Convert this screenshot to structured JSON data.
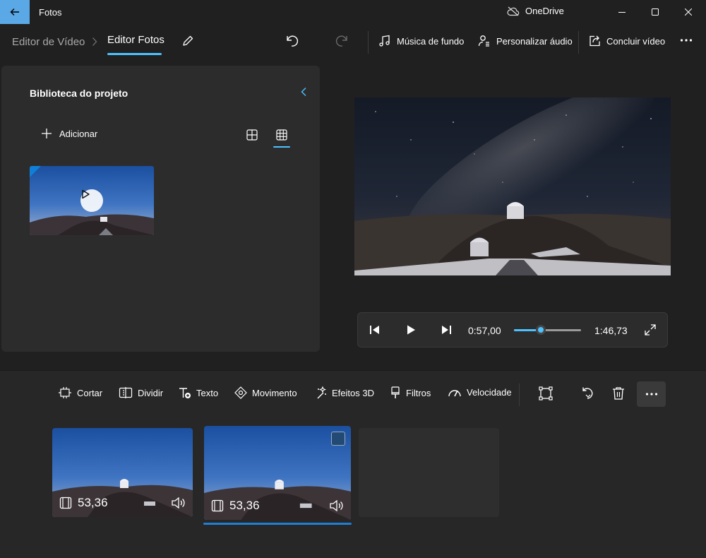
{
  "window": {
    "title": "Fotos",
    "onedrive_label": "OneDrive",
    "icons": [
      "back-arrow-icon",
      "cloud-off-icon",
      "minimize-icon",
      "maximize-icon",
      "close-icon"
    ]
  },
  "toolbar": {
    "breadcrumb": [
      "Editor de Vídeo",
      "Editor Fotos"
    ],
    "buttons": {
      "music": "Música de fundo",
      "audio": "Personalizar áudio",
      "finish": "Concluir vídeo"
    },
    "icons": [
      "pencil-icon",
      "undo-icon",
      "redo-icon",
      "music-note-icon",
      "custom-audio-icon",
      "share-icon",
      "more-icon"
    ]
  },
  "library": {
    "title": "Biblioteca do projeto",
    "add_label": "Adicionar",
    "view_modes": [
      "grid-large",
      "grid-small"
    ],
    "selected_view": "grid-small"
  },
  "player": {
    "current_time": "0:57,00",
    "total_time": "1:46,73",
    "progress": 0.4
  },
  "storyboard": {
    "tools": [
      "Cortar",
      "Dividir",
      "Texto",
      "Movimento",
      "Efeitos 3D",
      "Filtros",
      "Velocidade"
    ],
    "clips": [
      {
        "duration": "53,36",
        "selected": false
      },
      {
        "duration": "53,36",
        "selected": true
      }
    ]
  },
  "colors": {
    "accent": "#4cc2ff",
    "back_button": "#5aa8e6",
    "background": "#202020",
    "panel": "#2c2c2c"
  }
}
